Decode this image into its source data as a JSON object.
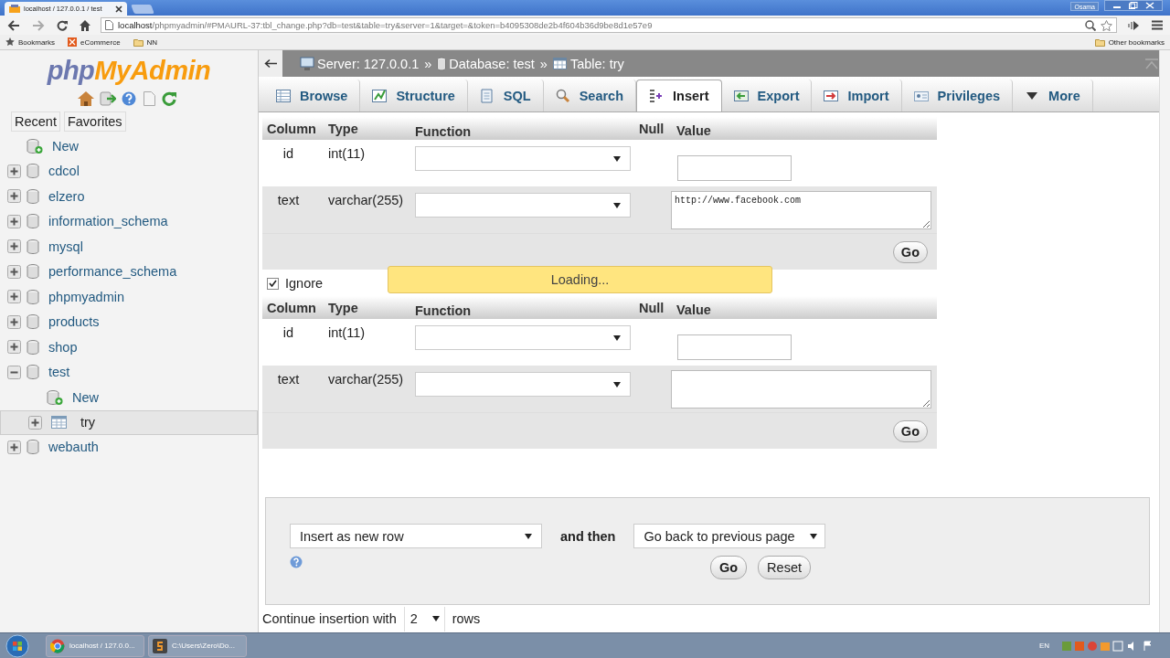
{
  "browser": {
    "tabs": [
      {
        "title": "localhost / 127.0.0.1 / test",
        "selected": true
      }
    ],
    "user": "Osama",
    "url_host": "localhost",
    "url_path": "/phpmyadmin/#PMAURL-37:tbl_change.php?db=test&table=try&server=1&target=&token=b4095308de2b4f604b36d9be8d1e57e9",
    "bookmarks": [
      "Bookmarks",
      "eCommerce",
      "NN"
    ],
    "other_bookmarks": "Other bookmarks"
  },
  "sidebar": {
    "logo_php": "php",
    "logo_myadmin": "MyAdmin",
    "buttons": [
      "Recent",
      "Favorites"
    ],
    "tree": [
      {
        "name": "New",
        "kind": "new",
        "selected": false
      },
      {
        "name": "cdcol",
        "kind": "db",
        "expanded": false,
        "selected": false
      },
      {
        "name": "elzero",
        "kind": "db",
        "expanded": false,
        "selected": false
      },
      {
        "name": "information_schema",
        "kind": "db",
        "expanded": false,
        "selected": false
      },
      {
        "name": "mysql",
        "kind": "db",
        "expanded": false,
        "selected": false
      },
      {
        "name": "performance_schema",
        "kind": "db",
        "expanded": false,
        "selected": false
      },
      {
        "name": "phpmyadmin",
        "kind": "db",
        "expanded": false,
        "selected": false
      },
      {
        "name": "products",
        "kind": "db",
        "expanded": false,
        "selected": false
      },
      {
        "name": "shop",
        "kind": "db",
        "expanded": false,
        "selected": false
      },
      {
        "name": "test",
        "kind": "db",
        "expanded": true,
        "selected": false,
        "children": [
          {
            "name": "New",
            "kind": "new",
            "selected": false
          },
          {
            "name": "try",
            "kind": "table",
            "expanded": false,
            "selected": true
          }
        ]
      },
      {
        "name": "webauth",
        "kind": "db",
        "expanded": false,
        "selected": false
      }
    ]
  },
  "main": {
    "breadcrumb": [
      {
        "kind": "server",
        "label": "Server: 127.0.0.1"
      },
      {
        "kind": "database",
        "label": "Database: test"
      },
      {
        "kind": "table",
        "label": "Table: try"
      }
    ],
    "separator": "»",
    "tabs": [
      {
        "label": "Browse",
        "selected": false
      },
      {
        "label": "Structure",
        "selected": false
      },
      {
        "label": "SQL",
        "selected": false
      },
      {
        "label": "Search",
        "selected": false
      },
      {
        "label": "Insert",
        "selected": true
      },
      {
        "label": "Export",
        "selected": false
      },
      {
        "label": "Import",
        "selected": false
      },
      {
        "label": "Privileges",
        "selected": false
      },
      {
        "label": "More",
        "selected": false
      }
    ],
    "forms": [
      {
        "columns": [
          "Column",
          "Type",
          "Function",
          "Null",
          "Value"
        ],
        "rows": [
          {
            "column": "id",
            "type": "int(11)",
            "kind": "input"
          },
          {
            "column": "text",
            "type": "varchar(255)",
            "kind": "textarea",
            "value": "http://www.facebook.com"
          }
        ],
        "go": "Go"
      },
      {
        "ignore": {
          "label": "Ignore",
          "checked": true
        },
        "columns": [
          "Column",
          "Type",
          "Function",
          "Null",
          "Value"
        ],
        "rows": [
          {
            "column": "id",
            "type": "int(11)",
            "kind": "input"
          },
          {
            "column": "text",
            "type": "varchar(255)",
            "kind": "textarea"
          }
        ],
        "go": "Go"
      }
    ],
    "loading": "Loading...",
    "bottom": {
      "insert_mode": "Insert as new row",
      "and_then": "and then",
      "after": "Go back to previous page",
      "go": "Go",
      "reset": "Reset"
    },
    "continue": {
      "label": "Continue insertion with",
      "count": "2",
      "unit": "rows"
    }
  },
  "taskbar": {
    "items": [
      "localhost / 127.0.0...",
      "C:\\Users\\Zero\\Do..."
    ],
    "language": "EN"
  }
}
